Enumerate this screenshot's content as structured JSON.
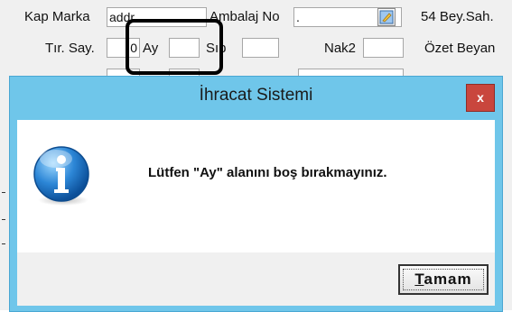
{
  "form": {
    "row1": {
      "kap_marka_label": "Kap Marka",
      "kap_marka_value": "addr",
      "ambalaj_no_label": "Ambalaj No",
      "ambalaj_no_value": ".",
      "bey_sah_label": "54 Bey.Sah."
    },
    "row2": {
      "tir_say_label": "Tır. Say.",
      "tir_say_value": "0",
      "ay_label": "Ay",
      "ay_value": "",
      "sip_label": "Sıp",
      "sip_value": "",
      "nak2_label": "Nak2",
      "nak2_value": "",
      "ozet_beyan_label": "Özet Beyan"
    }
  },
  "dialog": {
    "title": "İhracat Sistemi",
    "close_label": "x",
    "message": "Lütfen \"Ay\" alanını boş bırakmayınız.",
    "ok_button": {
      "mnemonic": "T",
      "rest": "amam"
    },
    "icon": "info-icon"
  }
}
